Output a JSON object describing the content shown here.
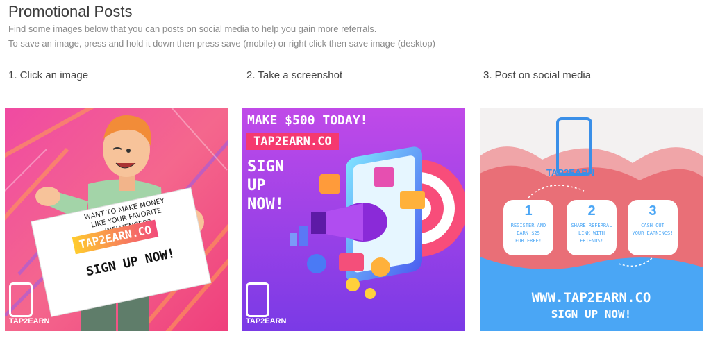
{
  "page": {
    "title": "Promotional Posts",
    "subtitle_line1": "Find some images below that you can posts on social media to help you gain more referrals.",
    "subtitle_line2": "To save an image, press and hold it down then press save (mobile) or right click then save image (desktop)"
  },
  "steps": [
    {
      "label": "1. Click an image"
    },
    {
      "label": "2. Take a screenshot"
    },
    {
      "label": "3. Post on social media"
    }
  ],
  "promo1": {
    "sign_line1": "WANT TO MAKE MONEY",
    "sign_line2": "LIKE YOUR FAVORITE INFLUENCER?",
    "sign_site": "TAP2EARN.CO",
    "sign_cta": "SIGN UP NOW!",
    "logo_text": "TAP2EARN"
  },
  "promo2": {
    "headline": "MAKE $500 TODAY!",
    "site": "TAP2EARN.CO",
    "cta_line1": "SIGN",
    "cta_line2": "UP",
    "cta_line3": "NOW!",
    "logo_text": "TAP2EARN"
  },
  "promo3": {
    "logo_text": "TAP2EARN",
    "steps": [
      {
        "number": "1",
        "line1": "REGISTER AND",
        "line2": "EARN $25",
        "line3": "FOR FREE!"
      },
      {
        "number": "2",
        "line1": "SHARE REFERRAL",
        "line2": "LINK WITH",
        "line3": "FRIENDS!"
      },
      {
        "number": "3",
        "line1": "CASH OUT",
        "line2": "YOUR EARNINGS!",
        "line3": ""
      }
    ],
    "site": "WWW.TAP2EARN.CO",
    "cta": "SIGN UP NOW!"
  },
  "colors": {
    "pink": "#f0378f",
    "purple": "#a34df0",
    "blue": "#4aa6f5",
    "salmon": "#f07f7f"
  }
}
